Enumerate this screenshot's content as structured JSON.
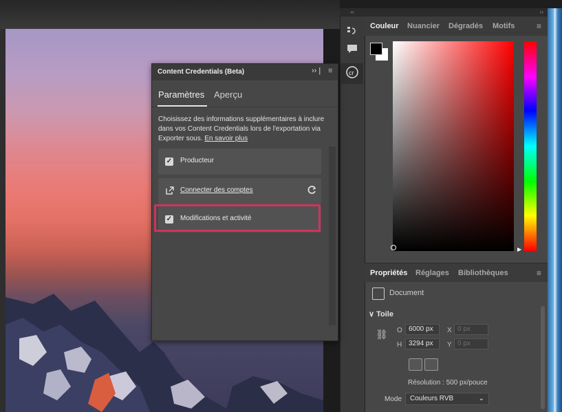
{
  "dialog": {
    "title": "Content Credentials (Beta)",
    "more": "›› |",
    "menu": "≡",
    "tabs": [
      "Paramètres",
      "Aperçu"
    ],
    "description": "Choisissez des informations supplémentaires à inclure dans vos Content Credentials lors de l'exportation via Exporter sous.",
    "learn_more": "En savoir plus",
    "options": [
      {
        "label": "Producteur",
        "checked": true
      },
      {
        "label": "Connecter des comptes",
        "checked": false
      },
      {
        "label": "Modifications et activité",
        "checked": true
      }
    ],
    "highlight_color": "#d1325d"
  },
  "toolstrip": {
    "collapse": "‹‹",
    "icons": [
      "history-icon",
      "comment-icon",
      "content-credentials-icon"
    ]
  },
  "color_panel": {
    "collapse": "››",
    "tabs": [
      "Couleur",
      "Nuancier",
      "Dégradés",
      "Motifs"
    ],
    "foreground": "#000000",
    "background": "#ffffff"
  },
  "properties_panel": {
    "tabs": [
      "Propriétés",
      "Réglages",
      "Bibliothèques"
    ],
    "document_label": "Document",
    "section": "Toile",
    "width_label": "O",
    "width_value": "6000 px",
    "height_label": "H",
    "height_value": "3294 px",
    "x_label": "X",
    "x_placeholder": "0 px",
    "y_label": "Y",
    "y_placeholder": "0 px",
    "resolution": "Résolution : 500 px/pouce",
    "mode_label": "Mode",
    "mode_value": "Couleurs RVB"
  }
}
